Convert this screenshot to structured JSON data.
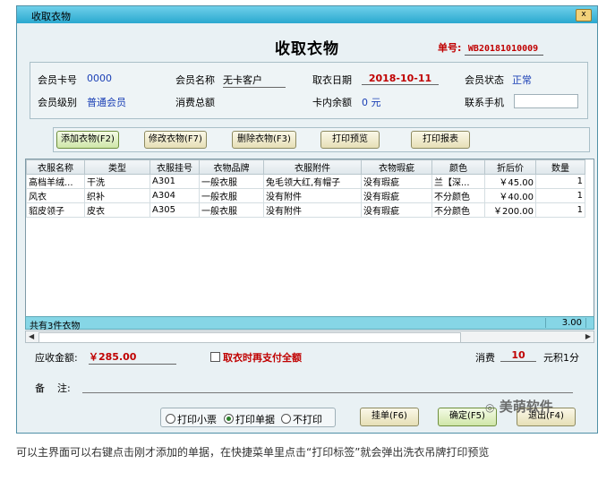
{
  "window": {
    "title": "收取衣物",
    "close_glyph": "x"
  },
  "header": {
    "title": "收取衣物",
    "order_label": "单号:",
    "order_no": "WB20181010009"
  },
  "info": {
    "card_label": "会员卡号",
    "card_value": "0000",
    "name_label": "会员名称",
    "name_value": "无卡客户",
    "date_label": "取衣日期",
    "date_value": "2018-10-11",
    "status_label": "会员状态",
    "status_value": "正常",
    "level_label": "会员级别",
    "level_value": "普通会员",
    "total_label": "消费总额",
    "balance_label": "卡内余额",
    "balance_value": "0 元",
    "phone_label": "联系手机"
  },
  "toolbar": {
    "add": "添加衣物(F2)",
    "edit": "修改衣物(F7)",
    "delete": "删除衣物(F3)",
    "preview": "打印预览",
    "report": "打印报表"
  },
  "table": {
    "headers": [
      "衣服名称",
      "类型",
      "衣服挂号",
      "衣物品牌",
      "衣服附件",
      "衣物瑕疵",
      "颜色",
      "折后价",
      "数量"
    ],
    "rows": [
      [
        "高档羊绒...",
        "干洗",
        "A301",
        "一般衣服",
        "兔毛领大红,有帽子",
        "没有瑕疵",
        "兰【深...",
        "￥45.00",
        "1"
      ],
      [
        "风衣",
        "织补",
        "A304",
        "一般衣服",
        "没有附件",
        "没有瑕疵",
        "不分颜色",
        "￥40.00",
        "1"
      ],
      [
        "貂皮领子",
        "皮衣",
        "A305",
        "一般衣服",
        "没有附件",
        "没有瑕疵",
        "不分颜色",
        "￥200.00",
        "1"
      ]
    ],
    "summary": "共有3件衣物",
    "summary_total": "3.00"
  },
  "footer": {
    "receivable_label": "应收金额:",
    "receivable_value": "￥285.00",
    "pay_on_pickup": "取衣时再支付全额",
    "points_label": "消费",
    "points_value": "10",
    "points_unit": "元积1分",
    "remark_label": "备    注:",
    "print_options": [
      "打印小票",
      "打印单据",
      "不打印"
    ],
    "selected_print_option": "打印单据",
    "hang": "挂单(F6)",
    "ok": "确定(F5)",
    "exit": "退出(F4)"
  },
  "watermark": "美萌软件",
  "caption": "可以主界面可以右键点击刚才添加的单据，在快捷菜单里点击“打印标签”就会弹出洗衣吊牌打印预览"
}
